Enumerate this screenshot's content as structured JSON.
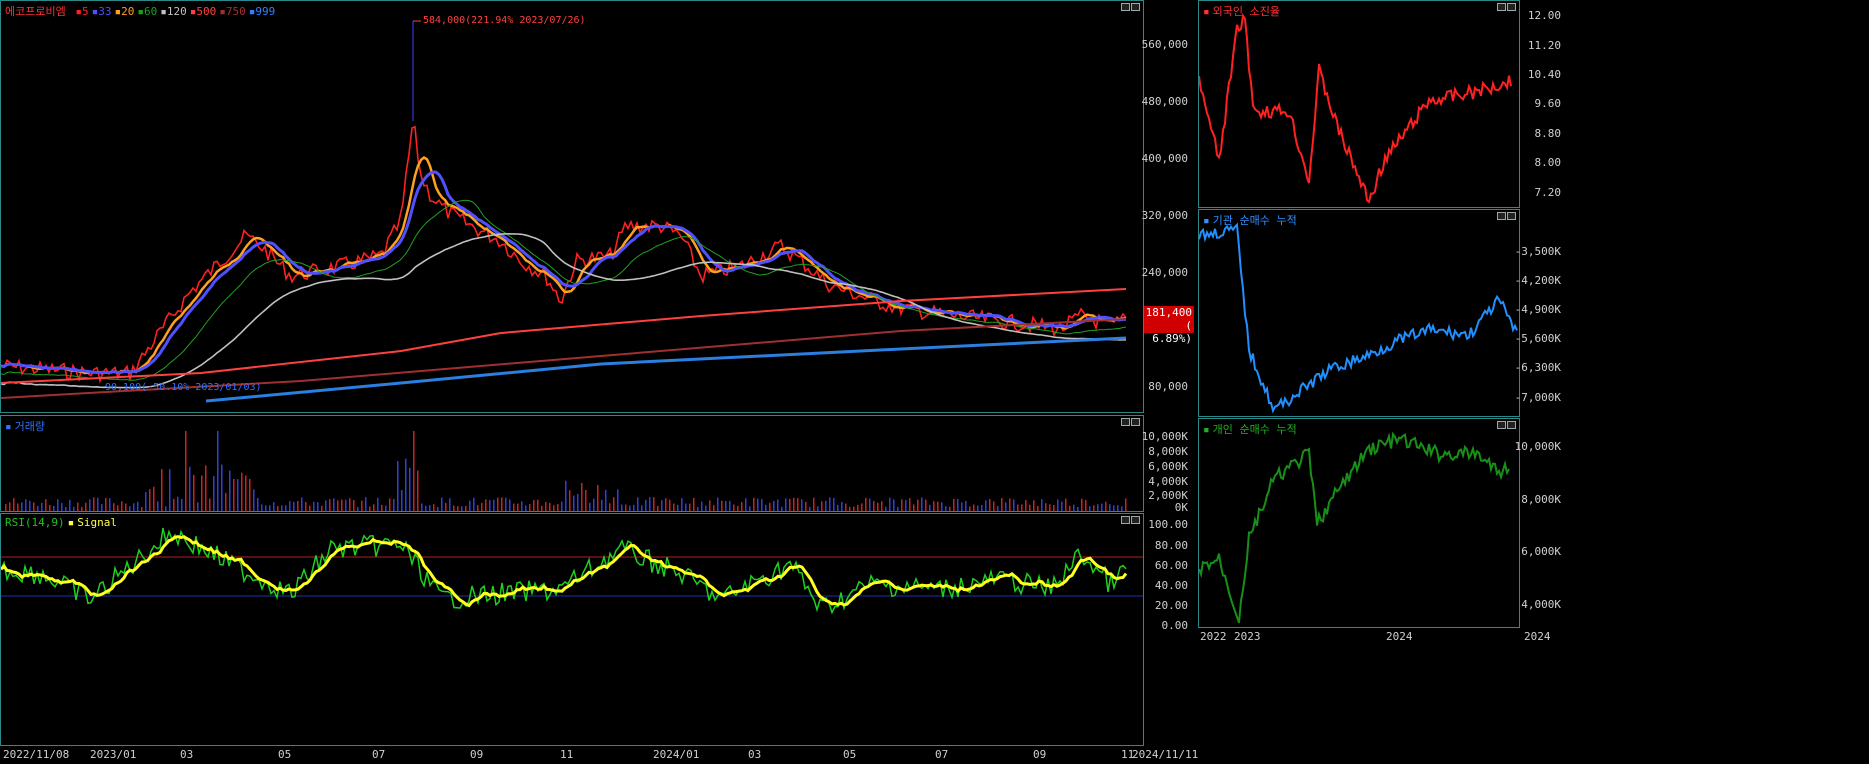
{
  "main": {
    "title": "에코프로비엠",
    "ma_legend": [
      {
        "label": "5",
        "color": "#ff2020"
      },
      {
        "label": "33",
        "color": "#5050ff"
      },
      {
        "label": "20",
        "color": "#ffa020"
      },
      {
        "label": "60",
        "color": "#20a020"
      },
      {
        "label": "120",
        "color": "#c0c0c0"
      },
      {
        "label": "500",
        "color": "#ff4040"
      },
      {
        "label": "750",
        "color": "#a03030"
      },
      {
        "label": "999",
        "color": "#3080ff"
      }
    ],
    "y_ticks": [
      "560,000",
      "480,000",
      "400,000",
      "320,000",
      "240,000",
      "80,000"
    ],
    "high_annotation": "584,000(221.94% 2023/07/26)",
    "low_annotation": "90,100(-50.10% 2023/01/03)",
    "current_price": "181,400",
    "current_change": "( 6.89%)"
  },
  "volume": {
    "title": "거래량",
    "y_ticks": [
      "10,000K",
      "8,000K",
      "6,000K",
      "4,000K",
      "2,000K",
      "0K"
    ]
  },
  "rsi": {
    "title": "RSI(14,9)",
    "signal_label": "Signal",
    "y_ticks": [
      "100.00",
      "80.00",
      "60.00",
      "40.00",
      "20.00",
      "0.00"
    ]
  },
  "x_axis": [
    "2022/11/08",
    "2023/01",
    "03",
    "05",
    "07",
    "09",
    "11",
    "2024/01",
    "03",
    "05",
    "07",
    "09",
    "11",
    "2024/11/11"
  ],
  "foreign": {
    "title": "외국인 소진율",
    "y_ticks": [
      "12.00",
      "11.20",
      "10.40",
      "9.60",
      "8.80",
      "8.00",
      "7.20"
    ]
  },
  "institution": {
    "title": "기관 순매수 누적",
    "y_ticks": [
      "-3,500K",
      "-4,200K",
      "-4,900K",
      "-5,600K",
      "-6,300K",
      "-7,000K"
    ]
  },
  "individual": {
    "title": "개인 순매수 누적",
    "y_ticks": [
      "10,000K",
      "8,000K",
      "6,000K",
      "4,000K"
    ]
  },
  "right_x_axis": [
    "2022",
    "2023",
    "2024",
    "2024"
  ]
}
